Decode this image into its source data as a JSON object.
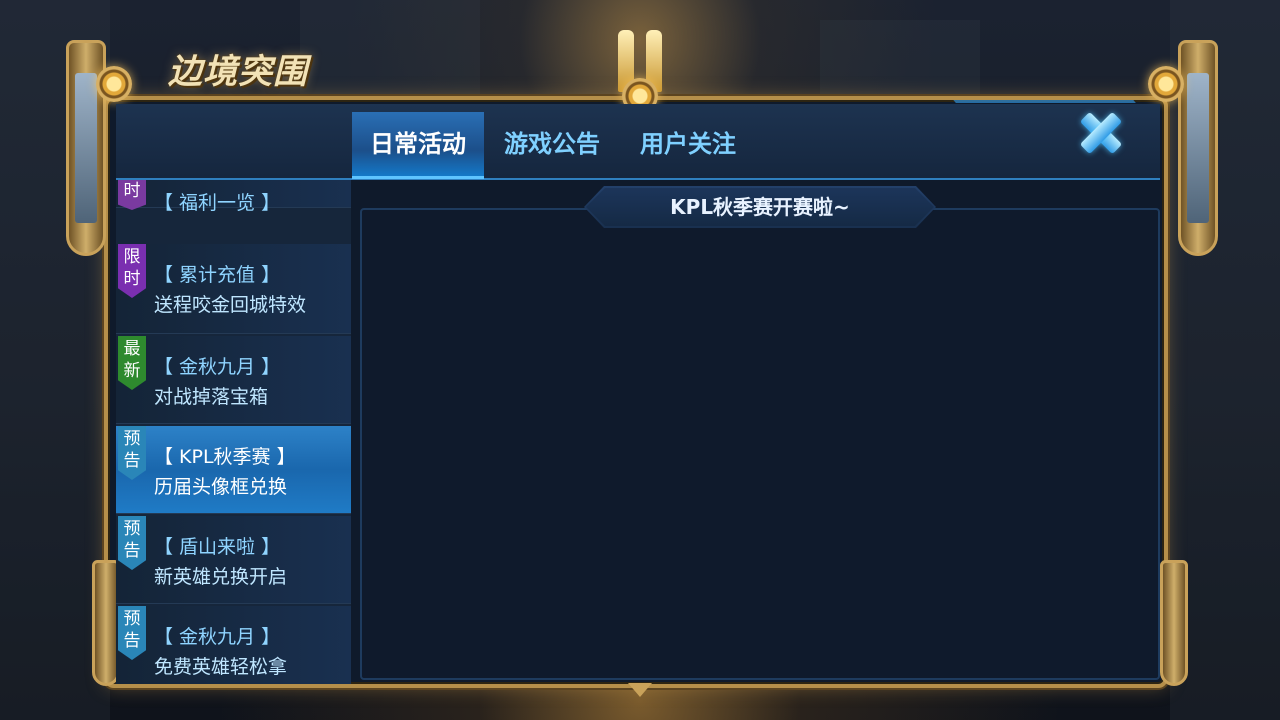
{
  "window": {
    "logo_text": "边境突围"
  },
  "tabs": [
    {
      "label": "日常活动",
      "active": true
    },
    {
      "label": "游戏公告",
      "active": false
    },
    {
      "label": "用户关注",
      "active": false
    }
  ],
  "close_button": {
    "icon": "close-x-icon"
  },
  "sidebar": {
    "items": [
      {
        "badge": [
          "时"
        ],
        "badge_color": "#7a3aa0",
        "line1": "【 福利一览 】",
        "line2": "",
        "active": false
      },
      {
        "badge": [
          "限",
          "时"
        ],
        "badge_color": "#7a2fb0",
        "line1": "【 累计充值 】",
        "line2": "送程咬金回城特效",
        "active": false
      },
      {
        "badge": [
          "最",
          "新"
        ],
        "badge_color": "#2e8a2e",
        "line1": "【 金秋九月 】",
        "line2": "对战掉落宝箱",
        "active": false
      },
      {
        "badge": [
          "预",
          "告"
        ],
        "badge_color": "#2a86b8",
        "line1": "【 KPL秋季赛 】",
        "line2": "历届头像框兑换",
        "active": true
      },
      {
        "badge": [
          "预",
          "告"
        ],
        "badge_color": "#2a86b8",
        "line1": "【 盾山来啦 】",
        "line2": "新英雄兑换开启",
        "active": false
      },
      {
        "badge": [
          "预",
          "告"
        ],
        "badge_color": "#2a86b8",
        "line1": "【 金秋九月 】",
        "line2": "免费英雄轻松拿",
        "active": false
      }
    ]
  },
  "content": {
    "title": "KPL秋季赛开赛啦~"
  },
  "colors": {
    "frame_gold": "#b58f4a",
    "tab_accent": "#5ec4ff",
    "active_item": "#2d82c8"
  }
}
